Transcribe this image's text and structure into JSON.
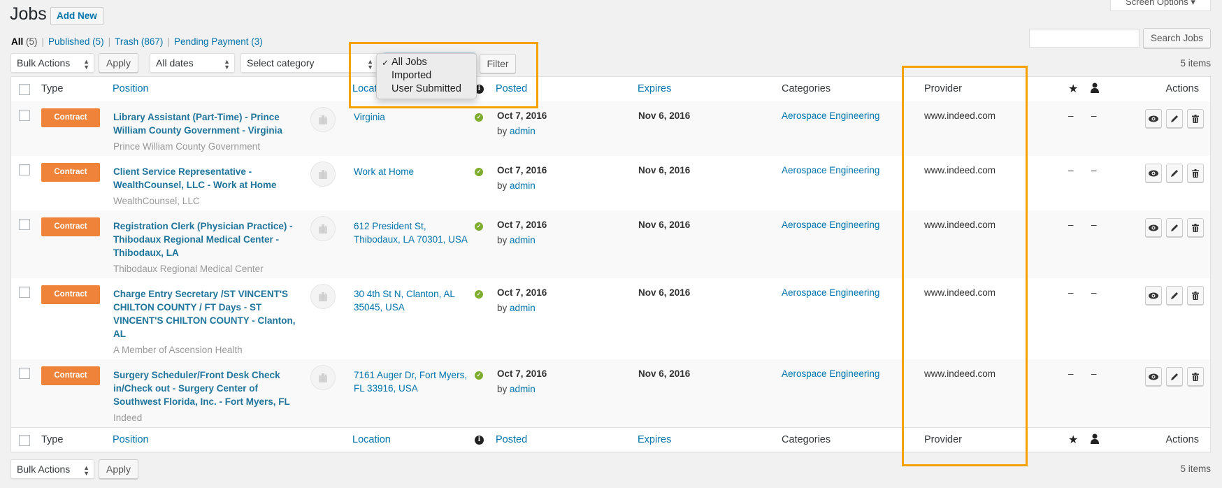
{
  "header": {
    "title": "Jobs",
    "add_new": "Add New",
    "screen_options": "Screen Options",
    "screen_options_icon": "caret-down-icon"
  },
  "views": [
    {
      "label": "All",
      "count": "(5)",
      "current": true
    },
    {
      "label": "Published",
      "count": "(5)"
    },
    {
      "label": "Trash",
      "count": "(867)"
    },
    {
      "label": "Pending Payment",
      "count": "(3)"
    }
  ],
  "search": {
    "value": "",
    "button": "Search Jobs"
  },
  "filters": {
    "bulk_actions": "Bulk Actions",
    "apply": "Apply",
    "dates": "All dates",
    "category": "Select category",
    "filter": "Filter",
    "source_dropdown": {
      "options": [
        "All Jobs",
        "Imported",
        "User Submitted"
      ],
      "selected": "All Jobs"
    }
  },
  "item_count": "5 items",
  "columns": {
    "type": "Type",
    "position": "Position",
    "location": "Location",
    "status_icon": "info-icon",
    "posted": "Posted",
    "expires": "Expires",
    "categories": "Categories",
    "provider": "Provider",
    "featured_icon": "star-icon",
    "filled_icon": "user-icon",
    "actions": "Actions"
  },
  "jobs": [
    {
      "type": "Contract",
      "title": "Library Assistant (Part-Time) - Prince William County Government - Virginia",
      "company": "Prince William County Government",
      "location": "Virginia",
      "posted": "Oct 7, 2016",
      "posted_by": "by",
      "author": "admin",
      "expires": "Nov 6, 2016",
      "category": "Aerospace Engineering",
      "provider": "www.indeed.com",
      "featured": "–",
      "filled": "–"
    },
    {
      "type": "Contract",
      "title": "Client Service Representative - WealthCounsel, LLC - Work at Home",
      "company": "WealthCounsel, LLC",
      "location": "Work at Home",
      "posted": "Oct 7, 2016",
      "posted_by": "by",
      "author": "admin",
      "expires": "Nov 6, 2016",
      "category": "Aerospace Engineering",
      "provider": "www.indeed.com",
      "featured": "–",
      "filled": "–"
    },
    {
      "type": "Contract",
      "title": "Registration Clerk (Physician Practice) - Thibodaux Regional Medical Center - Thibodaux, LA",
      "company": "Thibodaux Regional Medical Center",
      "location": "612 President St, Thibodaux, LA 70301, USA",
      "posted": "Oct 7, 2016",
      "posted_by": "by",
      "author": "admin",
      "expires": "Nov 6, 2016",
      "category": "Aerospace Engineering",
      "provider": "www.indeed.com",
      "featured": "–",
      "filled": "–"
    },
    {
      "type": "Contract",
      "title": "Charge Entry Secretary /ST VINCENT'S CHILTON COUNTY / FT Days - ST VINCENT'S CHILTON COUNTY - Clanton, AL",
      "company": "A Member of Ascension Health",
      "location": "30 4th St N, Clanton, AL 35045, USA",
      "posted": "Oct 7, 2016",
      "posted_by": "by",
      "author": "admin",
      "expires": "Nov 6, 2016",
      "category": "Aerospace Engineering",
      "provider": "www.indeed.com",
      "featured": "–",
      "filled": "–"
    },
    {
      "type": "Contract",
      "title": "Surgery Scheduler/Front Desk Check in/Check out - Surgery Center of Southwest Florida, Inc. - Fort Myers, FL",
      "company": "Indeed",
      "location": "7161 Auger Dr, Fort Myers, FL 33916, USA",
      "posted": "Oct 7, 2016",
      "posted_by": "by",
      "author": "admin",
      "expires": "Nov 6, 2016",
      "category": "Aerospace Engineering",
      "provider": "www.indeed.com",
      "featured": "–",
      "filled": "–"
    }
  ],
  "row_actions": [
    "view-icon",
    "edit-icon",
    "delete-icon"
  ],
  "colors": {
    "accent": "#0073aa",
    "type_badge": "#f0833a",
    "status_ok": "#7ead2e",
    "highlight": "#f5a200"
  }
}
